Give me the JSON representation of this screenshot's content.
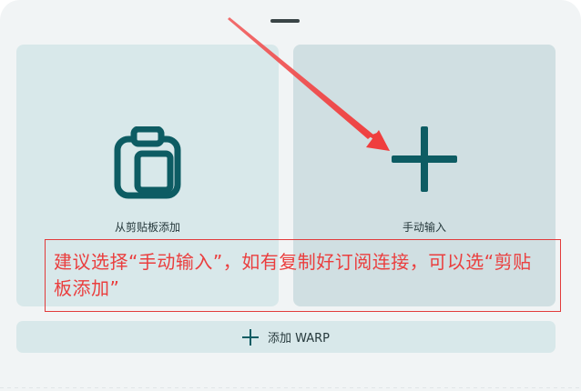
{
  "sheet": {
    "cards": [
      {
        "label": "从剪贴板添加",
        "icon": "clipboard-icon"
      },
      {
        "label": "手动输入",
        "icon": "plus-icon"
      }
    ],
    "add_button": {
      "label": "添加 WARP",
      "icon": "plus-icon"
    }
  },
  "annotation": {
    "text": "建议选择“手动输入”，如有复制好订阅连接，可以选“剪贴板添加”",
    "color": "#ea3e3e"
  },
  "colors": {
    "sheet_bg": "#f1f4f5",
    "card_bg": "#d8e8ea",
    "card_bg_active": "#d0dfe2",
    "icon_teal": "#0d5c63"
  }
}
